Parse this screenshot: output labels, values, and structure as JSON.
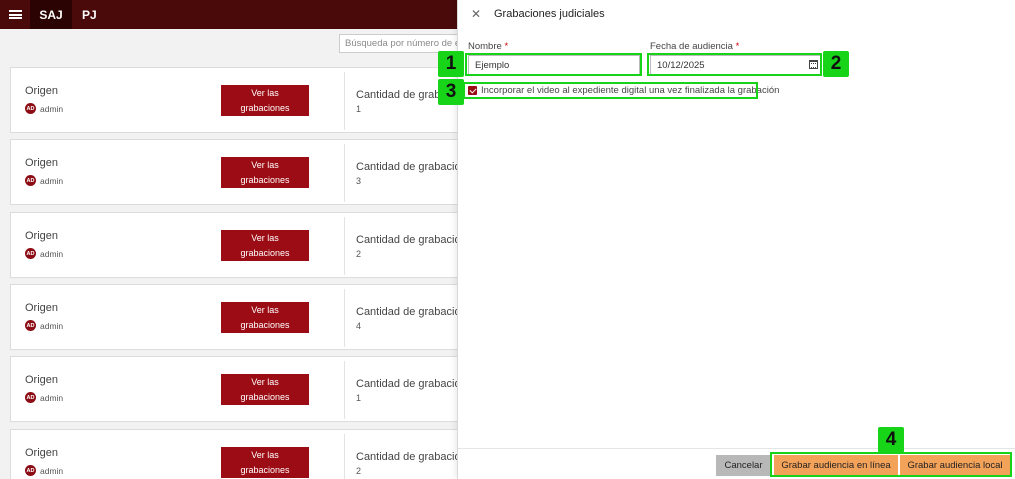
{
  "app": {
    "brand_primary": "SAJ",
    "brand_secondary": "PJ",
    "menu_icon": "hamburger-icon"
  },
  "search": {
    "placeholder": "Búsqueda por número de exp"
  },
  "cards": [
    {
      "origin_label": "Origen",
      "user_initials": "AD",
      "user_name": "admin",
      "button_label_1": "Ver las",
      "button_label_2": "grabaciones",
      "qty_label": "Cantidad de grabaciones",
      "qty_value": "1"
    },
    {
      "origin_label": "Origen",
      "user_initials": "AD",
      "user_name": "admin",
      "button_label_1": "Ver las",
      "button_label_2": "grabaciones",
      "qty_label": "Cantidad de grabaciones",
      "qty_value": "3"
    },
    {
      "origin_label": "Origen",
      "user_initials": "AD",
      "user_name": "admin",
      "button_label_1": "Ver las",
      "button_label_2": "grabaciones",
      "qty_label": "Cantidad de grabaciones",
      "qty_value": "2"
    },
    {
      "origin_label": "Origen",
      "user_initials": "AD",
      "user_name": "admin",
      "button_label_1": "Ver las",
      "button_label_2": "grabaciones",
      "qty_label": "Cantidad de grabaciones",
      "qty_value": "4"
    },
    {
      "origin_label": "Origen",
      "user_initials": "AD",
      "user_name": "admin",
      "button_label_1": "Ver las",
      "button_label_2": "grabaciones",
      "qty_label": "Cantidad de grabaciones",
      "qty_value": "1"
    },
    {
      "origin_label": "Origen",
      "user_initials": "AD",
      "user_name": "admin",
      "button_label_1": "Ver las",
      "button_label_2": "grabaciones",
      "qty_label": "Cantidad de grabaciones",
      "qty_value": "2"
    }
  ],
  "panel": {
    "title": "Grabaciones judiciales",
    "name_label": "Nombre",
    "name_value": "Ejemplo",
    "date_label": "Fecha de audiencia",
    "date_value": "10/12/2025",
    "required_mark": "*",
    "checkbox_label": "Incorporar el video al expediente digital una vez finalizada la grabación",
    "checkbox_checked": true,
    "cancel_label": "Cancelar",
    "record_online_label": "Grabar audiencia en línea",
    "record_local_label": "Grabar audiencia local"
  },
  "annotations": [
    "1",
    "2",
    "3",
    "4"
  ],
  "colors": {
    "topbar": "#4a0a0a",
    "brand_bg": "#2b0303",
    "button_red": "#9b0c14",
    "orange": "#f3a25a",
    "highlight": "#18d418"
  }
}
